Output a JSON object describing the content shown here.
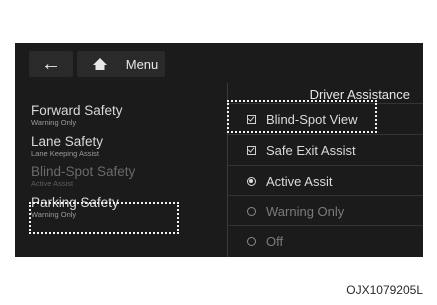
{
  "topbar": {
    "back_icon": "back-arrow-icon",
    "home_icon": "home-icon",
    "menu_label": "Menu"
  },
  "left_menu": [
    {
      "title": "Forward Safety",
      "subtitle": "Warning Only"
    },
    {
      "title": "Lane Safety",
      "subtitle": "Lane Keeping Assist"
    },
    {
      "title": "Blind-Spot Safety",
      "subtitle": "Active Assist"
    },
    {
      "title": "Parking Safety",
      "subtitle": "Warning Only"
    }
  ],
  "right_panel": {
    "header": "Driver Assistance",
    "checkboxes": [
      {
        "label": "Blind-Spot View",
        "checked": true
      },
      {
        "label": "Safe Exit Assist",
        "checked": true
      }
    ],
    "radio_options": [
      {
        "label": "Active Assit",
        "selected": true
      },
      {
        "label": "Warning Only",
        "selected": false
      },
      {
        "label": "Off",
        "selected": false
      }
    ]
  },
  "caption": "OJX1079205L",
  "colors": {
    "screen_bg": "#1b1b1c",
    "highlight_border": "#f2f2f2"
  }
}
